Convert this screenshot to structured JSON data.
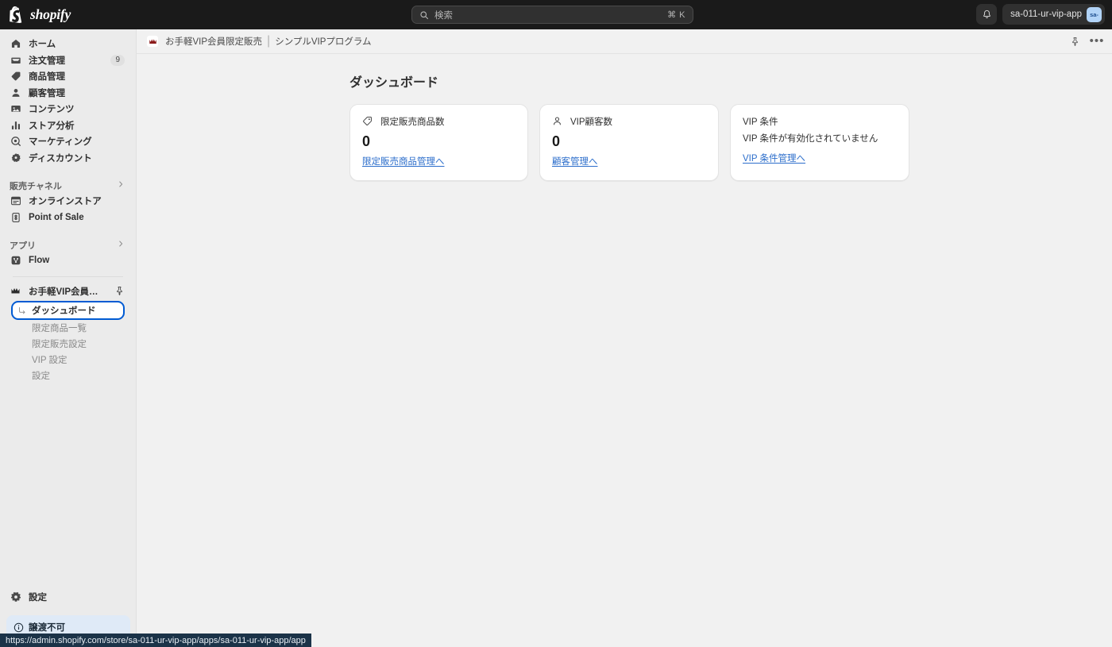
{
  "topbar": {
    "brand": "shopify",
    "brand_icon": "shopify-bag-icon",
    "search": {
      "placeholder": "検索",
      "shortcut": "⌘ K",
      "icon": "search-icon"
    },
    "notifications_icon": "bell-icon",
    "user": {
      "name": "sa-011-ur-vip-app",
      "avatar_initials": "sa-"
    }
  },
  "sidebar": {
    "items": [
      {
        "label": "ホーム",
        "icon": "home-icon",
        "badge": ""
      },
      {
        "label": "注文管理",
        "icon": "orders-inbox-icon",
        "badge": "9"
      },
      {
        "label": "商品管理",
        "icon": "products-tag-icon",
        "badge": ""
      },
      {
        "label": "顧客管理",
        "icon": "customers-person-icon",
        "badge": ""
      },
      {
        "label": "コンテンツ",
        "icon": "content-media-icon",
        "badge": ""
      },
      {
        "label": "ストア分析",
        "icon": "analytics-bars-icon",
        "badge": ""
      },
      {
        "label": "マーケティング",
        "icon": "marketing-megaphone-icon",
        "badge": ""
      },
      {
        "label": "ディスカウント",
        "icon": "discounts-icon",
        "badge": ""
      }
    ],
    "sales_channels": {
      "title": "販売チャネル",
      "chevron": "chevron-right-icon",
      "items": [
        {
          "label": "オンラインストア",
          "icon": "online-store-icon"
        },
        {
          "label": "Point of Sale",
          "icon": "point-of-sale-icon"
        }
      ]
    },
    "apps": {
      "title": "アプリ",
      "chevron": "chevron-right-icon",
      "items": [
        {
          "label": "Flow",
          "icon": "flow-icon"
        }
      ]
    },
    "active_app": {
      "label": "お手軽VIP会員限定販売...",
      "icon": "crown-icon",
      "pin_icon": "pin-icon",
      "subitems": [
        {
          "label": "ダッシュボード",
          "active": true
        },
        {
          "label": "限定商品一覧",
          "active": false
        },
        {
          "label": "限定販売設定",
          "active": false
        },
        {
          "label": "VIP 設定",
          "active": false
        },
        {
          "label": "設定",
          "active": false
        }
      ]
    },
    "settings": {
      "label": "設定",
      "icon": "gear-icon"
    },
    "notice": {
      "label": "譲渡不可",
      "icon": "info-circle-icon"
    }
  },
  "page_header": {
    "app_icon": "crown-badge-icon",
    "breadcrumb_app": "お手軽VIP会員限定販売",
    "breadcrumb_sep": "|",
    "breadcrumb_page": "シンプルVIPプログラム",
    "pin_icon": "pin-icon",
    "more_icon": "more-horizontal-icon"
  },
  "main": {
    "title": "ダッシュボード",
    "cards": [
      {
        "icon": "tag-icon",
        "title": "限定販売商品数",
        "value": "0",
        "link": "限定販売商品管理へ"
      },
      {
        "icon": "person-icon",
        "title": "VIP顧客数",
        "value": "0",
        "link": "顧客管理へ"
      },
      {
        "icon": "",
        "title": "VIP 条件",
        "description": "VIP 条件が有効化されていません",
        "link": "VIP 条件管理へ"
      }
    ]
  },
  "status_bar": {
    "url": "https://admin.shopify.com/store/sa-011-ur-vip-app/apps/sa-011-ur-vip-app/app"
  },
  "colors": {
    "topbar_bg": "#1a1a1a",
    "sidebar_bg": "#ebebeb",
    "canvas_bg": "#f1f1f1",
    "card_bg": "#ffffff",
    "link": "#2c6ecb",
    "focus_ring": "#005bd3",
    "notice_bg": "#dfeaf7",
    "status_bg": "#1b3348"
  }
}
